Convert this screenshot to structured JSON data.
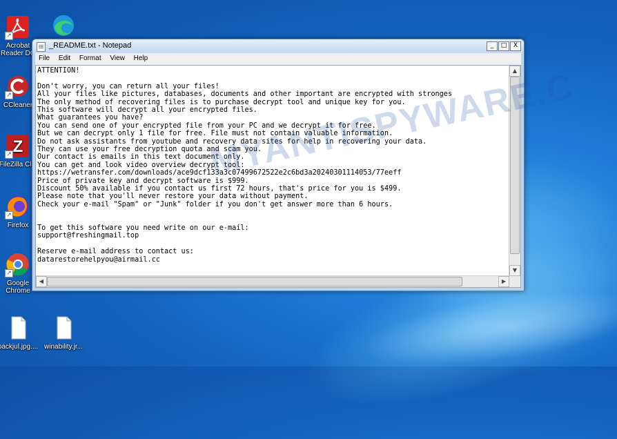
{
  "desktop": {
    "icons": [
      {
        "label": "Acrobat Reader DC",
        "label_visible": "Acrobat\nReader DC"
      },
      {
        "label": "CCleaner"
      },
      {
        "label": "FileZilla Client",
        "label_visible": "FileZilla Clie"
      },
      {
        "label": "Firefox"
      },
      {
        "label": "Google Chrome",
        "label_visible": "Google\nChrome"
      },
      {
        "label": "packjul.jpg....",
        "label_visible": "packjul.jpg...."
      },
      {
        "label": "winability.jr...",
        "label_visible": "winability.jr..."
      }
    ],
    "accent_color": "#1565c0"
  },
  "window": {
    "title": "_README.txt - Notepad",
    "buttons": {
      "minimize": "_",
      "maximize": "□",
      "close": "X"
    },
    "menu": [
      "File",
      "Edit",
      "Format",
      "View",
      "Help"
    ]
  },
  "document": {
    "lines": [
      "ATTENTION!",
      "",
      "Don't worry, you can return all your files!",
      "All your files like pictures, databases, documents and other important are encrypted with stronges",
      "The only method of recovering files is to purchase decrypt tool and unique key for you.",
      "This software will decrypt all your encrypted files.",
      "What guarantees you have?",
      "You can send one of your encrypted file from your PC and we decrypt it for free.",
      "But we can decrypt only 1 file for free. File must not contain valuable information.",
      "Do not ask assistants from youtube and recovery data sites for help in recovering your data.",
      "They can use your free decryption quota and scam you.",
      "Our contact is emails in this text document only.",
      "You can get and look video overview decrypt tool:",
      "https://wetransfer.com/downloads/ace9dcf133a3c07499672522e2c6bd3a20240301114053/77eeff",
      "Price of private key and decrypt software is $999.",
      "Discount 50% available if you contact us first 72 hours, that's price for you is $499.",
      "Please note that you'll never restore your data without payment.",
      "Check your e-mail \"Spam\" or \"Junk\" folder if you don't get answer more than 6 hours.",
      "",
      "",
      "To get this software you need write on our e-mail:",
      "support@freshingmail.top",
      "",
      "Reserve e-mail address to contact us:",
      "datarestorehelpyou@airmail.cc"
    ]
  },
  "watermark": "MYANTISPYWARE.C"
}
